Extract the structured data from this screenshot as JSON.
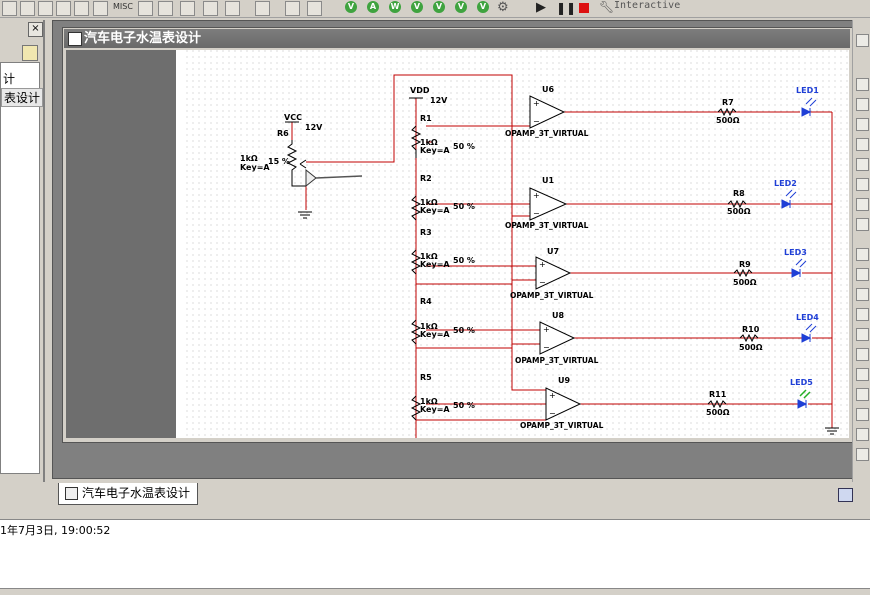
{
  "toolbar": {
    "misc_label": "MISC",
    "sim_buttons": [
      "V",
      "A",
      "W",
      "V",
      "V",
      "V",
      "V"
    ],
    "interactive_label": "Interactive"
  },
  "left_panel": {
    "items": [
      "计",
      "表设计"
    ]
  },
  "document": {
    "title": "汽车电子水温表设计",
    "tab_label": "汽车电子水温表设计"
  },
  "status": {
    "timestamp": "1年7月3日, 19:00:52"
  },
  "schematic": {
    "vcc_label": "VCC",
    "vcc_voltage": "12V",
    "r6_name": "R6",
    "r6_value": "1kΩ",
    "r6_key": "Key=A",
    "r6_percent": "15 %",
    "vdd_label": "VDD",
    "vdd_voltage": "12V",
    "pots": [
      {
        "name": "R1",
        "value": "1kΩ",
        "key": "Key=A",
        "percent": "50 %"
      },
      {
        "name": "R2",
        "value": "1kΩ",
        "key": "Key=A",
        "percent": "50 %"
      },
      {
        "name": "R3",
        "value": "1kΩ",
        "key": "Key=A",
        "percent": "50 %"
      },
      {
        "name": "R4",
        "value": "1kΩ",
        "key": "Key=A",
        "percent": "50 %"
      },
      {
        "name": "R5",
        "value": "1kΩ",
        "key": "Key=A",
        "percent": "50 %"
      }
    ],
    "opamps": [
      {
        "name": "U6",
        "model": "OPAMP_3T_VIRTUAL"
      },
      {
        "name": "U1",
        "model": "OPAMP_3T_VIRTUAL"
      },
      {
        "name": "U7",
        "model": "OPAMP_3T_VIRTUAL"
      },
      {
        "name": "U8",
        "model": "OPAMP_3T_VIRTUAL"
      },
      {
        "name": "U9",
        "model": "OPAMP_3T_VIRTUAL"
      }
    ],
    "resistors": [
      {
        "name": "R7",
        "value": "500Ω"
      },
      {
        "name": "R8",
        "value": "500Ω"
      },
      {
        "name": "R9",
        "value": "500Ω"
      },
      {
        "name": "R10",
        "value": "500Ω"
      },
      {
        "name": "R11",
        "value": "500Ω"
      }
    ],
    "leds": [
      "LED1",
      "LED2",
      "LED3",
      "LED4",
      "LED5"
    ],
    "colors": {
      "wire": "#c00000",
      "led": "#1f3fd6",
      "led_lit": "#26b026",
      "part": "#000000"
    }
  }
}
